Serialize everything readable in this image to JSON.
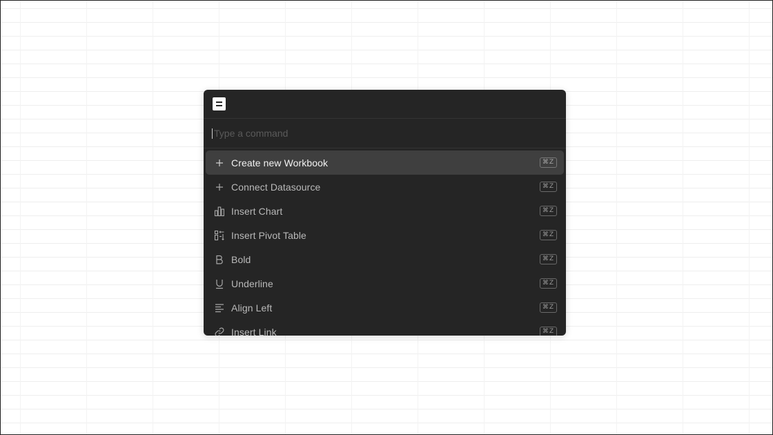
{
  "search": {
    "placeholder": "Type a command",
    "value": ""
  },
  "commands": [
    {
      "label": "Create new Workbook",
      "icon": "plus-icon",
      "shortcut": "⌘Z",
      "active": true
    },
    {
      "label": "Connect Datasource",
      "icon": "plus-icon",
      "shortcut": "⌘Z",
      "active": false
    },
    {
      "label": "Insert Chart",
      "icon": "bar-chart-icon",
      "shortcut": "⌘Z",
      "active": false
    },
    {
      "label": "Insert Pivot Table",
      "icon": "pivot-table-icon",
      "shortcut": "⌘Z",
      "active": false
    },
    {
      "label": "Bold",
      "icon": "bold-icon",
      "shortcut": "⌘Z",
      "active": false
    },
    {
      "label": "Underline",
      "icon": "underline-icon",
      "shortcut": "⌘Z",
      "active": false
    },
    {
      "label": "Align Left",
      "icon": "align-left-icon",
      "shortcut": "⌘Z",
      "active": false
    },
    {
      "label": "Insert Link",
      "icon": "link-icon",
      "shortcut": "⌘Z",
      "active": false
    }
  ],
  "colors": {
    "palette_bg": "#252525",
    "active_row": "#3f3f3f",
    "text": "#b9b9b9",
    "grid_line": "#eeeeee"
  }
}
